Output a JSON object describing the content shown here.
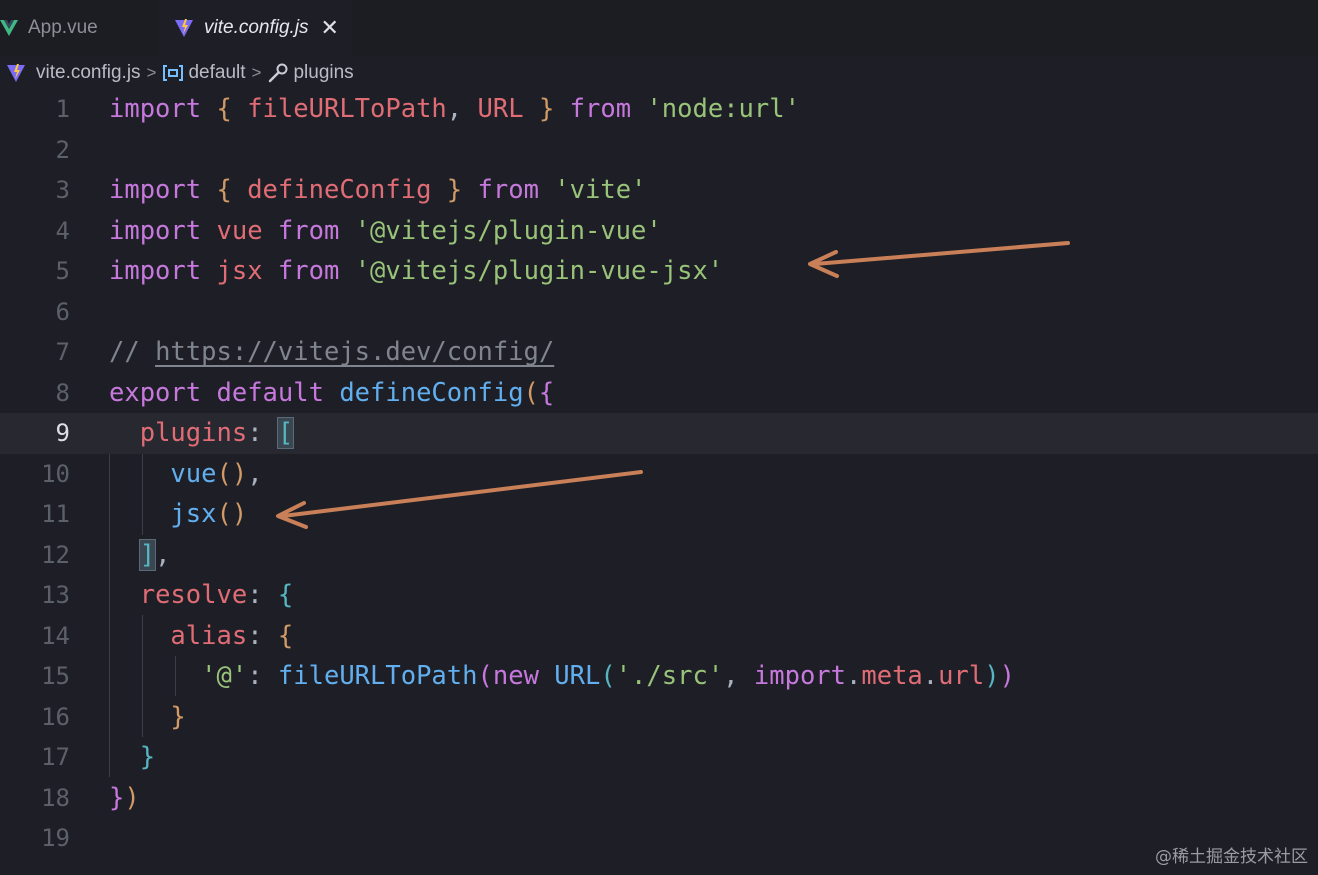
{
  "tabs": [
    {
      "label": "App.vue",
      "icon": "vue-icon",
      "active": false
    },
    {
      "label": "vite.config.js",
      "icon": "vite-icon",
      "active": true
    }
  ],
  "tab_close_glyph": "✕",
  "breadcrumb": {
    "file": "vite.config.js",
    "symbol1": "default",
    "symbol2": "plugins",
    "separator": ">"
  },
  "editor": {
    "current_line": 9,
    "line_numbers": [
      "1",
      "2",
      "3",
      "4",
      "5",
      "6",
      "7",
      "8",
      "9",
      "10",
      "11",
      "12",
      "13",
      "14",
      "15",
      "16",
      "17",
      "18",
      "19"
    ],
    "lines": [
      "import { fileURLToPath, URL } from 'node:url'",
      "",
      "import { defineConfig } from 'vite'",
      "import vue from '@vitejs/plugin-vue'",
      "import jsx from '@vitejs/plugin-vue-jsx'",
      "",
      "// https://vitejs.dev/config/",
      "export default defineConfig({",
      "  plugins: [",
      "    vue(),",
      "    jsx()",
      "  ],",
      "  resolve: {",
      "    alias: {",
      "      '@': fileURLToPath(new URL('./src', import.meta.url))",
      "    }",
      "  }",
      "})",
      ""
    ]
  },
  "colors": {
    "keyword": "#c678dd",
    "identifier": "#e06c75",
    "function": "#61afef",
    "string": "#98c379",
    "annotation_arrow": "#c97f57"
  },
  "watermark": "@稀土掘金技术社区"
}
